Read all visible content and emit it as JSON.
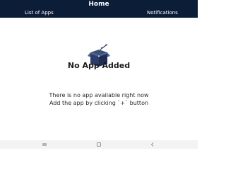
{
  "header": {
    "title": "Home",
    "tabs": [
      {
        "label": "List of Apps"
      },
      {
        "label": "Notifications"
      }
    ]
  },
  "empty_state": {
    "icon": "empty-box-icon",
    "title": "No App Added",
    "message_line1": "There is no app available right now",
    "message_line2": "Add the app by clicking `+` button"
  },
  "nav_bar": {
    "icons": [
      "recent-apps-icon",
      "home-icon",
      "back-icon"
    ]
  },
  "colors": {
    "header_bg": "#0c1d38",
    "icon_blue": "#2c3e67"
  }
}
